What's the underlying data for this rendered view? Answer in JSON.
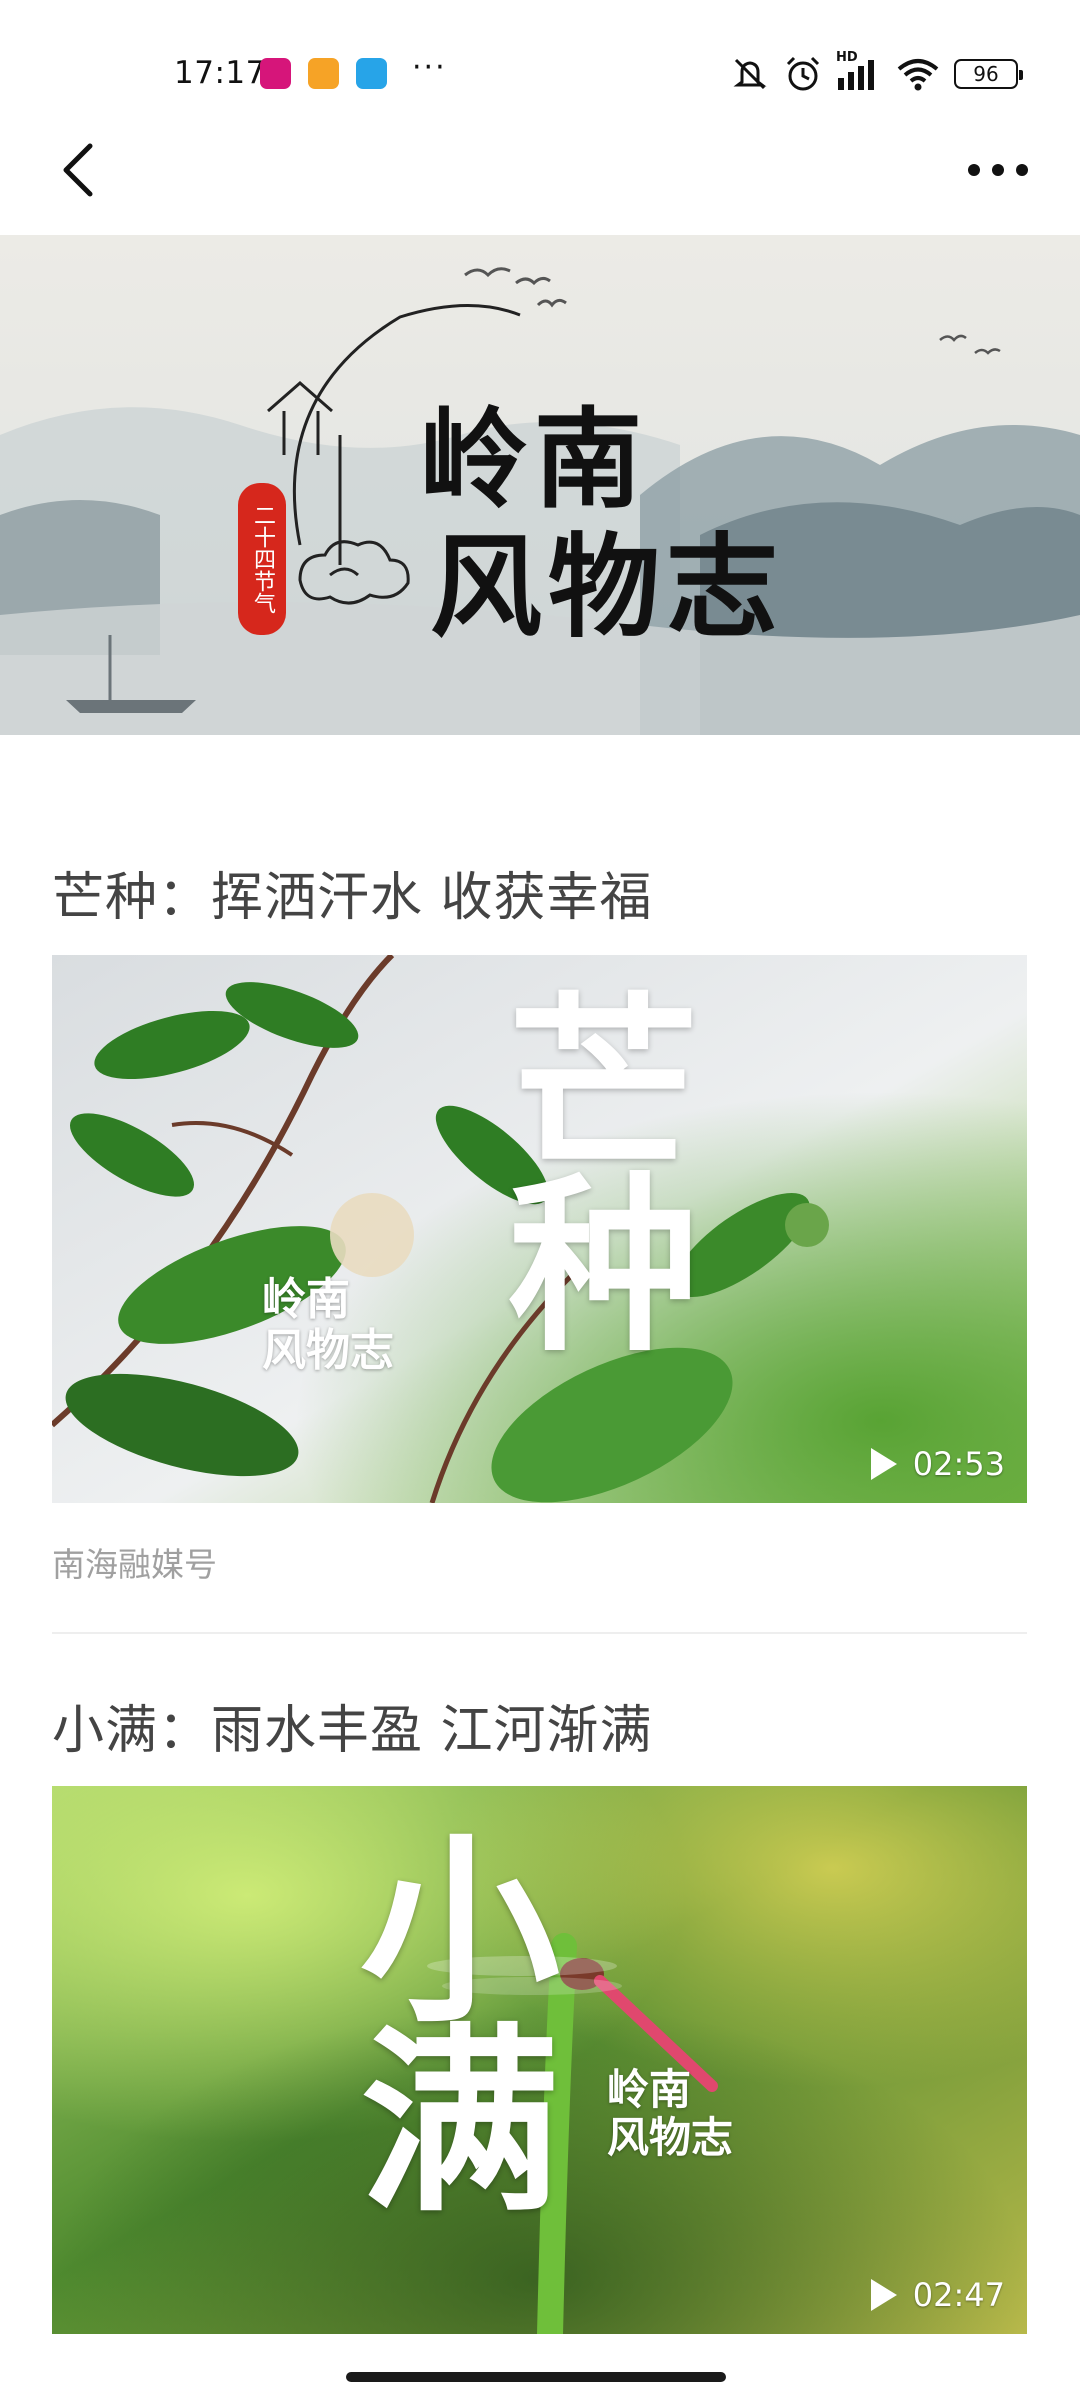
{
  "status_bar": {
    "time": "17:17",
    "app_icons": [
      {
        "name": "app-icon-pink",
        "color": "#d6157a"
      },
      {
        "name": "app-icon-orange",
        "color": "#f6a326"
      },
      {
        "name": "app-icon-blue",
        "color": "#27a4e8"
      }
    ],
    "more_dots": "···",
    "network_label": "HD",
    "battery": "96"
  },
  "nav": {
    "back_icon": "chevron-left-icon",
    "more_icon": "more-horizontal-icon"
  },
  "banner": {
    "title_line1": "岭南",
    "title_line2": "风物志",
    "seal_text": "二十四节气"
  },
  "articles": [
    {
      "title": "芒种：挥洒汗水 收获幸福",
      "video_big_text": "芒种",
      "logo_line1": "岭南",
      "logo_line2": "风物志",
      "duration": "02:53",
      "source": "南海融媒号"
    },
    {
      "title": "小满：雨水丰盈 江河渐满",
      "video_big_text": "小满",
      "logo_line1": "岭南",
      "logo_line2": "风物志",
      "duration": "02:47"
    }
  ]
}
